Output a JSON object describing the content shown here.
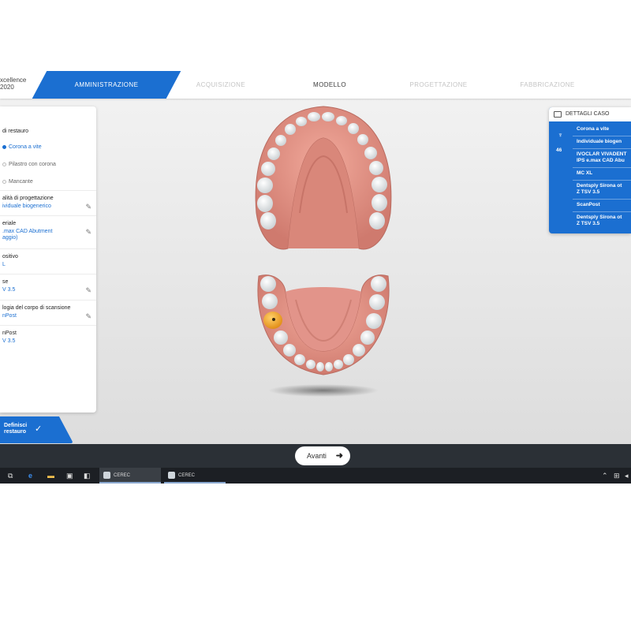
{
  "topbar": {
    "brand_line1": "xcellence",
    "brand_line2": "2020",
    "steps": [
      "AMMINISTRAZIONE",
      "ACQUISIZIONE",
      "MODELLO",
      "PROGETTAZIONE",
      "FABBRICAZIONE"
    ]
  },
  "left_panel": {
    "section_title": "di restauro",
    "options": [
      "Corona a vite",
      "Pilastro con corona",
      "Mancante"
    ],
    "selected_option": "Corona a vite",
    "fields": [
      {
        "label": "alità di progettazione",
        "value": "ividuale biogenerico"
      },
      {
        "label": "eriale",
        "value": ".max CAD Abutment",
        "value2": "aggio)"
      },
      {
        "label": "ositivo",
        "value": "L"
      },
      {
        "label": "se",
        "value": "V 3.5"
      },
      {
        "label": "logia del corpo di scansione",
        "value": "nPost"
      },
      {
        "label": "nPost",
        "value": "V 3.5"
      }
    ]
  },
  "define_button": {
    "line1": "Definisci",
    "line2": "restauro"
  },
  "right_panel": {
    "title": "DETTAGLI CASO",
    "tooth_number": "46",
    "lines": [
      "Corona a vite",
      "Individuale biogen",
      "IVOCLAR VIVADENT",
      "IPS e.max CAD Abu",
      "MC XL",
      "Dentsply Sirona ot",
      "Z TSV 3.5",
      "ScanPost",
      "Dentsply Sirona ot",
      "Z TSV 3.5"
    ]
  },
  "bottom_bar": {
    "next_label": "Avanti"
  },
  "taskbar": {
    "app1": "CEREC",
    "app2": "CEREC"
  },
  "colors": {
    "accent": "#1b6fd1",
    "highlight_tooth": "#f0a01c",
    "gum": "#e08c80"
  },
  "icons": [
    "pencil-icon",
    "check-icon",
    "arrow-right-icon",
    "tooth-icon",
    "windows-edge-icon",
    "folder-icon"
  ]
}
